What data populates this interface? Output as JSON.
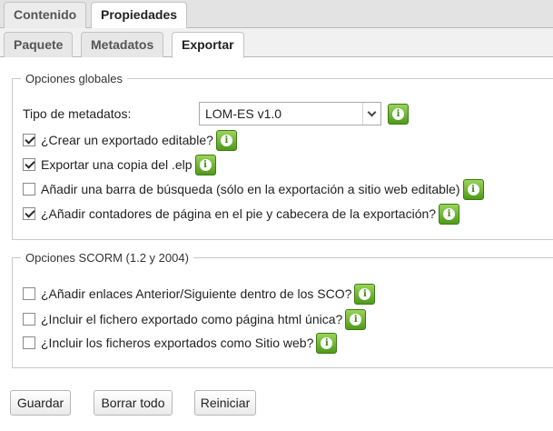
{
  "tabs": {
    "main": [
      {
        "label": "Contenido"
      },
      {
        "label": "Propiedades",
        "active": true
      }
    ],
    "sub": [
      {
        "label": "Paquete"
      },
      {
        "label": "Metadatos"
      },
      {
        "label": "Exportar",
        "active": true
      }
    ]
  },
  "global": {
    "legend": "Opciones globales",
    "metadata_label": "Tipo de metadatos:",
    "metadata_selected": "LOM-ES v1.0",
    "options": [
      {
        "label": "¿Crear un exportado editable?",
        "checked": true
      },
      {
        "label": "Exportar una copia del .elp",
        "checked": true
      },
      {
        "label": "Añadir una barra de búsqueda (sólo en la exportación a sitio web editable)",
        "checked": false
      },
      {
        "label": "¿Añadir contadores de página en el pie y cabecera de la exportación?",
        "checked": true
      }
    ]
  },
  "scorm": {
    "legend": "Opciones SCORM (1.2 y 2004)",
    "options": [
      {
        "label": "¿Añadir enlaces Anterior/Siguiente dentro de los SCO?",
        "checked": false
      },
      {
        "label": "¿Incluir el fichero exportado como página html única?",
        "checked": false
      },
      {
        "label": "¿Incluir los ficheros exportados como Sitio web?",
        "checked": false
      }
    ]
  },
  "buttons": {
    "save": "Guardar",
    "clear": "Borrar todo",
    "reset": "Reiniciar"
  },
  "icons": {
    "info": "info-icon",
    "info_glyph": "i",
    "dropdown": "chevron-down-icon"
  },
  "colors": {
    "info_green": "#4f9a1a"
  }
}
